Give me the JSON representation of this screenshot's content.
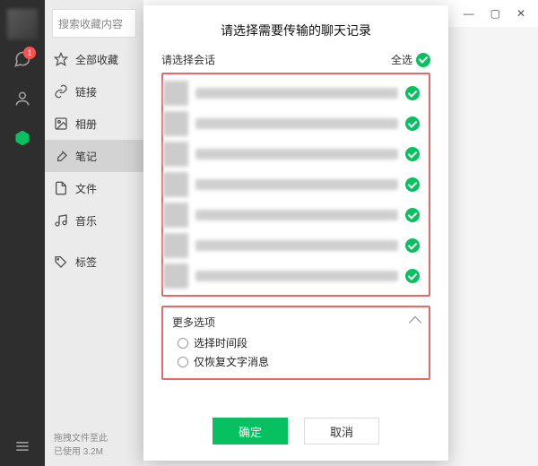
{
  "nav": {
    "badge": "1"
  },
  "sidebar": {
    "search_placeholder": "搜索收藏内容",
    "items": [
      {
        "label": "全部收藏"
      },
      {
        "label": "链接"
      },
      {
        "label": "相册"
      },
      {
        "label": "笔记"
      },
      {
        "label": "文件"
      },
      {
        "label": "音乐"
      },
      {
        "label": "标签"
      }
    ],
    "footer_line1": "拖拽文件至此",
    "footer_line2": "已使用 3.2M"
  },
  "titlebar": {
    "pin": "⇱",
    "min": "—",
    "max": "▢",
    "close": "✕"
  },
  "dialog": {
    "title": "请选择需要传输的聊天记录",
    "select_label": "请选择会话",
    "select_all": "全选",
    "conversations": [
      {
        "checked": true
      },
      {
        "checked": true
      },
      {
        "checked": true
      },
      {
        "checked": true
      },
      {
        "checked": true
      },
      {
        "checked": true
      },
      {
        "checked": true
      }
    ],
    "more_label": "更多选项",
    "options": [
      {
        "label": "选择时间段"
      },
      {
        "label": "仅恢复文字消息"
      }
    ],
    "ok": "确定",
    "cancel": "取消"
  }
}
